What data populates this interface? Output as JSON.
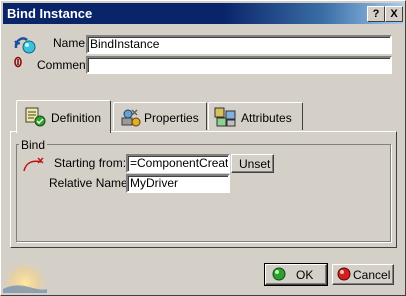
{
  "window": {
    "title": "Bind Instance"
  },
  "title_buttons": {
    "help": "?",
    "close": "X"
  },
  "form": {
    "name_label": "Name:",
    "name_value": "BindInstance",
    "comment_label": "Comment:",
    "comment_value": ""
  },
  "tabs": [
    {
      "label": "Definition",
      "active": true
    },
    {
      "label": "Properties",
      "active": false
    },
    {
      "label": "Attributes",
      "active": false
    }
  ],
  "bind": {
    "group_label": "Bind",
    "starting_from_label": "Starting from:",
    "starting_from_value": "=ComponentCreatio",
    "unset_label": "Unset",
    "relative_name_label": "Relative Name:",
    "relative_name_value": "MyDriver"
  },
  "footer": {
    "ok_label": "OK",
    "cancel_label": "Cancel"
  },
  "colors": {
    "title_bar": "#0a246a",
    "dialog_bg": "#d4d0c8",
    "ok_icon": "#2e9e2e",
    "cancel_icon": "#d02020"
  },
  "icons": [
    "knowledge-object-icon",
    "comment-icon",
    "definition-tab-icon",
    "properties-tab-icon",
    "attributes-tab-icon",
    "bind-curve-icon",
    "ok-icon",
    "cancel-icon"
  ]
}
